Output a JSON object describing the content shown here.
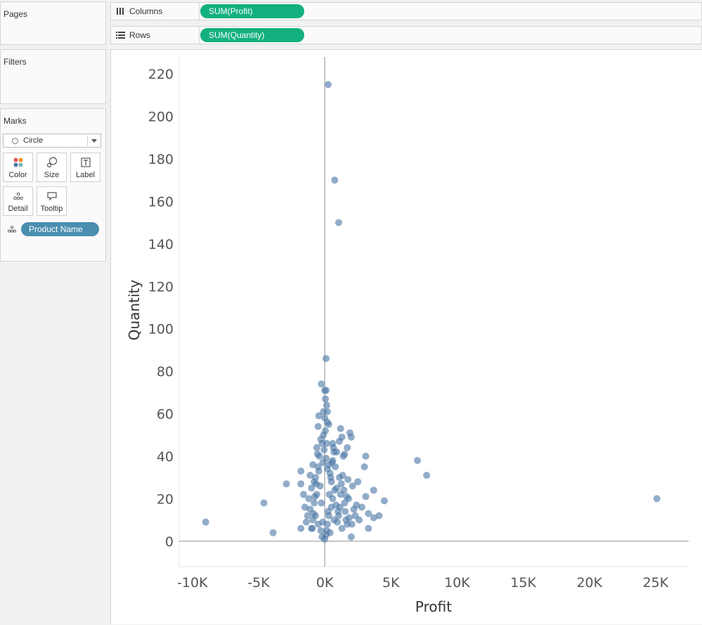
{
  "sidebar": {
    "pages_title": "Pages",
    "filters_title": "Filters",
    "marks_title": "Marks",
    "mark_type": "Circle",
    "buttons": {
      "color": "Color",
      "size": "Size",
      "label": "Label",
      "detail": "Detail",
      "tooltip": "Tooltip"
    },
    "detail_pill": "Product Name"
  },
  "shelves": {
    "columns_label": "Columns",
    "columns_pill": "SUM(Profit)",
    "rows_label": "Rows",
    "rows_pill": "SUM(Quantity)"
  },
  "colors": {
    "measure_pill": "#12b07e",
    "dimension_pill": "#4a8eb0",
    "mark": "#4e79a7"
  },
  "chart_data": {
    "type": "scatter",
    "xlabel": "Profit",
    "ylabel": "Quantity",
    "xlim": [
      -11000,
      27500
    ],
    "ylim": [
      -12,
      228
    ],
    "x_ticks": [
      -10000,
      -5000,
      0,
      5000,
      10000,
      15000,
      20000,
      25000
    ],
    "x_tick_labels": [
      "-10K",
      "-5K",
      "0K",
      "5K",
      "10K",
      "15K",
      "20K",
      "25K"
    ],
    "y_ticks": [
      0,
      20,
      40,
      60,
      80,
      100,
      120,
      140,
      160,
      180,
      200,
      220
    ],
    "y_tick_labels": [
      "0",
      "20",
      "40",
      "60",
      "80",
      "100",
      "120",
      "140",
      "160",
      "180",
      "200",
      "220"
    ],
    "grid": false,
    "zero_lines": true,
    "points": [
      [
        250,
        215
      ],
      [
        750,
        170
      ],
      [
        1050,
        150
      ],
      [
        100,
        86
      ],
      [
        -250,
        74
      ],
      [
        0,
        71
      ],
      [
        100,
        71
      ],
      [
        50,
        67
      ],
      [
        150,
        64
      ],
      [
        -100,
        61
      ],
      [
        200,
        61
      ],
      [
        -450,
        59
      ],
      [
        0,
        58
      ],
      [
        200,
        56
      ],
      [
        -500,
        54
      ],
      [
        300,
        55
      ],
      [
        1200,
        53
      ],
      [
        1900,
        51
      ],
      [
        2000,
        49
      ],
      [
        1300,
        49
      ],
      [
        -200,
        46
      ],
      [
        150,
        46
      ],
      [
        600,
        46
      ],
      [
        1700,
        44
      ],
      [
        700,
        42
      ],
      [
        1500,
        41
      ],
      [
        3100,
        40
      ],
      [
        1400,
        40
      ],
      [
        -1800,
        33
      ],
      [
        -2900,
        27
      ],
      [
        -1800,
        27
      ],
      [
        -4600,
        18
      ],
      [
        -9000,
        9
      ],
      [
        -3900,
        4
      ],
      [
        -1800,
        6
      ],
      [
        -1000,
        6
      ],
      [
        7000,
        38
      ],
      [
        7700,
        31
      ],
      [
        25100,
        20
      ],
      [
        3000,
        35
      ],
      [
        3700,
        24
      ],
      [
        2100,
        26
      ],
      [
        2500,
        28
      ],
      [
        4500,
        19
      ],
      [
        3100,
        21
      ],
      [
        2800,
        16
      ],
      [
        3300,
        13
      ],
      [
        4100,
        12
      ],
      [
        3700,
        11
      ],
      [
        3300,
        6
      ],
      [
        2000,
        2
      ],
      [
        1700,
        8
      ],
      [
        1300,
        6
      ],
      [
        1600,
        10
      ],
      [
        2200,
        15
      ],
      [
        2400,
        17
      ],
      [
        1800,
        20
      ],
      [
        900,
        25
      ],
      [
        1100,
        30
      ],
      [
        800,
        35
      ],
      [
        600,
        38
      ],
      [
        1200,
        22
      ],
      [
        1500,
        18
      ],
      [
        1000,
        14
      ],
      [
        700,
        10
      ],
      [
        -600,
        22
      ],
      [
        -800,
        18
      ],
      [
        -1100,
        15
      ],
      [
        -700,
        12
      ],
      [
        -900,
        10
      ],
      [
        -500,
        8
      ],
      [
        -300,
        5
      ],
      [
        -1200,
        20
      ],
      [
        -1000,
        25
      ],
      [
        -700,
        30
      ],
      [
        -500,
        35
      ],
      [
        -400,
        40
      ],
      [
        -600,
        44
      ],
      [
        -300,
        48
      ],
      [
        500,
        28
      ],
      [
        400,
        32
      ],
      [
        300,
        36
      ],
      [
        600,
        20
      ],
      [
        500,
        16
      ],
      [
        300,
        12
      ],
      [
        200,
        8
      ],
      [
        100,
        3
      ],
      [
        400,
        4
      ],
      [
        -200,
        2
      ],
      [
        0,
        1
      ],
      [
        150,
        5
      ],
      [
        -150,
        9
      ],
      [
        250,
        14
      ],
      [
        -250,
        18
      ],
      [
        350,
        22
      ],
      [
        -350,
        26
      ],
      [
        450,
        30
      ],
      [
        -450,
        33
      ],
      [
        550,
        37
      ],
      [
        -550,
        41
      ],
      [
        650,
        44
      ],
      [
        -650,
        27
      ],
      [
        750,
        24
      ],
      [
        -750,
        21
      ],
      [
        850,
        17
      ],
      [
        -850,
        13
      ],
      [
        950,
        9
      ],
      [
        -950,
        6
      ],
      [
        1050,
        12
      ],
      [
        1150,
        16
      ],
      [
        1250,
        27
      ],
      [
        1350,
        31
      ],
      [
        1450,
        24
      ],
      [
        1550,
        14
      ],
      [
        1650,
        21
      ],
      [
        1750,
        29
      ],
      [
        1850,
        11
      ],
      [
        2050,
        8
      ],
      [
        2300,
        12
      ],
      [
        2600,
        10
      ],
      [
        -1300,
        12
      ],
      [
        -1500,
        16
      ],
      [
        -1400,
        9
      ],
      [
        -1600,
        22
      ],
      [
        -1100,
        31
      ],
      [
        -900,
        36
      ],
      [
        -800,
        28
      ],
      [
        900,
        42
      ],
      [
        1100,
        47
      ],
      [
        -100,
        50
      ],
      [
        50,
        52
      ],
      [
        -50,
        43
      ],
      [
        100,
        39
      ],
      [
        -150,
        37
      ],
      [
        200,
        34
      ]
    ]
  }
}
